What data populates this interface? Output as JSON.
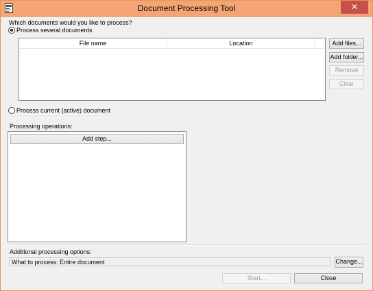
{
  "window": {
    "title": "Document Processing Tool",
    "close_glyph": "✕"
  },
  "documents": {
    "question": "Which documents would you like to process?",
    "option_several": "Process several documents",
    "option_current": "Process current (active) document",
    "columns": [
      "File name",
      "Location"
    ],
    "buttons": {
      "add_files": "Add files...",
      "add_folder": "Add folder...",
      "remove": "Remove",
      "clear": "Clear"
    }
  },
  "operations": {
    "label": "Processing operations:",
    "add_step": "Add step..."
  },
  "additional": {
    "label": "Additional processing options:",
    "what_to_process": "What to process: Entire document",
    "change": "Change..."
  },
  "footer": {
    "start": "Start...",
    "close": "Close"
  },
  "colors": {
    "titlebar": "#f5a575",
    "close_button": "#c7504a",
    "window_bg": "#f0f0f0"
  }
}
